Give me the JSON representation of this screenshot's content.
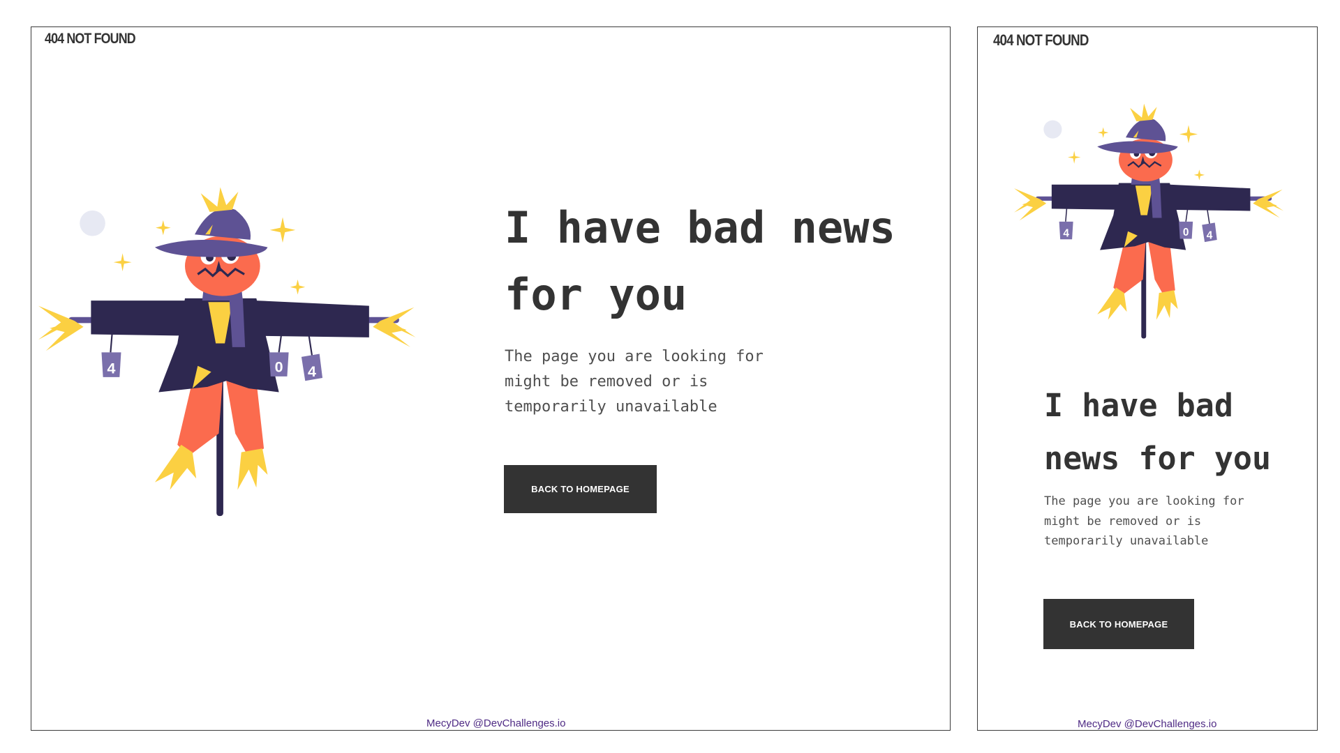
{
  "brand": {
    "text": "404 NOT FOUND"
  },
  "content": {
    "headline": "I have bad news for you",
    "description": "The page you are looking for might be removed or is temporarily unavailable",
    "button_label": "BACK TO HOMEPAGE",
    "credit": "MecyDev @DevChallenges.io"
  },
  "illustration": {
    "icon": "scarecrow-illustration",
    "can_labels": [
      "4",
      "0",
      "4"
    ]
  },
  "colors": {
    "text": "#333333",
    "button_bg": "#333333",
    "button_text": "#ffffff",
    "credit_text": "#4e2a84",
    "hat": "#5e5294",
    "coat": "#2e2850",
    "face": "#fb6b4e",
    "straw": "#fbd042",
    "moon": "#e7e9f3"
  }
}
